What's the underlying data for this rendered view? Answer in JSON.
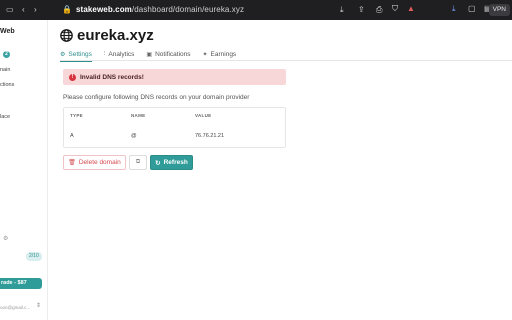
{
  "browser": {
    "domain": "stakeweb.com",
    "path": "/dashboard/domain/eureka.xyz",
    "vpn_label": "VPN"
  },
  "sidebar": {
    "brand": "Web",
    "badge": "2",
    "items": [
      "nain",
      "ctions",
      "lace"
    ],
    "count_badge": "2/10",
    "upgrade_label": "rade - $87",
    "email": "oon@gmail.c..."
  },
  "main": {
    "title": "eureka.xyz",
    "tabs": [
      {
        "label": "Settings",
        "icon": "gear-icon"
      },
      {
        "label": "Analytics",
        "icon": "chart-icon"
      },
      {
        "label": "Notifications",
        "icon": "bell-icon"
      },
      {
        "label": "Earnings",
        "icon": "money-icon"
      }
    ],
    "alert": {
      "text": "Invalid DNS records!"
    },
    "instructions": "Please configure following DNS records on your domain provider",
    "table": {
      "headers": [
        "TYPE",
        "NAME",
        "VALUE"
      ],
      "rows": [
        [
          "A",
          "@",
          "76.76.21.21"
        ]
      ]
    },
    "buttons": {
      "delete": "Delete domain",
      "refresh": "Refresh"
    }
  },
  "colors": {
    "accent": "#2f9c99",
    "danger": "#d6333f",
    "alert_bg": "#f8d7d9"
  }
}
